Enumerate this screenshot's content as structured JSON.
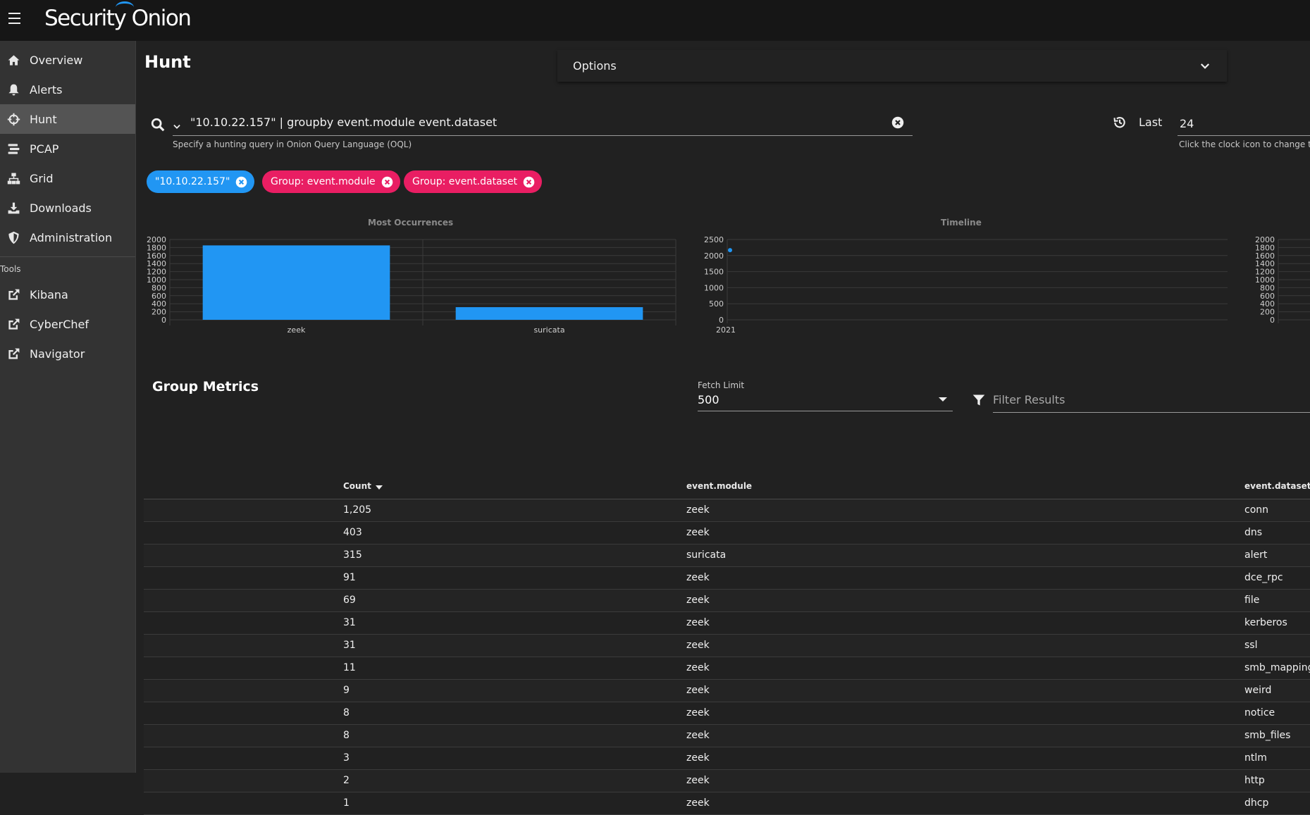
{
  "app": {
    "logo_text": "Security Onion"
  },
  "sidebar": {
    "items": [
      {
        "label": "Overview",
        "icon": "home-icon"
      },
      {
        "label": "Alerts",
        "icon": "bell-icon"
      },
      {
        "label": "Hunt",
        "icon": "crosshairs-icon",
        "active": true
      },
      {
        "label": "PCAP",
        "icon": "stream-icon"
      },
      {
        "label": "Grid",
        "icon": "sitemap-icon"
      },
      {
        "label": "Downloads",
        "icon": "download-icon"
      },
      {
        "label": "Administration",
        "icon": "shield-icon"
      }
    ],
    "tools_label": "Tools",
    "tools": [
      {
        "label": "Kibana",
        "icon": "external-link-icon"
      },
      {
        "label": "CyberChef",
        "icon": "external-link-icon"
      },
      {
        "label": "Navigator",
        "icon": "external-link-icon"
      }
    ]
  },
  "page": {
    "title": "Hunt"
  },
  "options": {
    "label": "Options"
  },
  "query": {
    "value": "\"10.10.22.157\" | groupby event.module event.dataset",
    "hint": "Specify a hunting query in Onion Query Language (OQL)"
  },
  "date_range": {
    "label": "Last",
    "value": "24",
    "hint": "Click the clock icon to change t"
  },
  "chips": [
    {
      "label": "\"10.10.22.157\"",
      "color": "#2196f3"
    },
    {
      "label": "Group: event.module",
      "color": "#e91e63"
    },
    {
      "label": "Group: event.dataset",
      "color": "#e91e63"
    }
  ],
  "chart_data": [
    {
      "type": "bar",
      "title": "Most Occurrences",
      "categories": [
        "zeek",
        "suricata"
      ],
      "values": [
        1853,
        315
      ],
      "ylim": [
        0,
        2000
      ],
      "yticks": [
        "2000",
        "1800",
        "1600",
        "1400",
        "1200",
        "1000",
        "800",
        "600",
        "400",
        "200",
        "0"
      ],
      "color": "#2196f3",
      "grid": true
    },
    {
      "type": "scatter",
      "title": "Timeline",
      "x": [
        "2021"
      ],
      "values": [
        2168
      ],
      "ylim": [
        0,
        2500
      ],
      "yticks": [
        "2500",
        "2000",
        "1500",
        "1000",
        "500",
        "0"
      ],
      "xticks": [
        "2021"
      ],
      "color": "#2196f3",
      "grid": true
    },
    {
      "type": "bar",
      "title": "",
      "yticks": [
        "2000",
        "1800",
        "1600",
        "1400",
        "1200",
        "1000",
        "800",
        "600",
        "400",
        "200",
        "0"
      ],
      "ylim": [
        0,
        2000
      ]
    }
  ],
  "group_metrics": {
    "title": "Group Metrics",
    "fetch_limit_label": "Fetch Limit",
    "fetch_limit_value": "500",
    "filter_placeholder": "Filter Results",
    "columns": [
      "Count",
      "event.module",
      "event.dataset"
    ],
    "rows": [
      [
        "1,205",
        "zeek",
        "conn"
      ],
      [
        "403",
        "zeek",
        "dns"
      ],
      [
        "315",
        "suricata",
        "alert"
      ],
      [
        "91",
        "zeek",
        "dce_rpc"
      ],
      [
        "69",
        "zeek",
        "file"
      ],
      [
        "31",
        "zeek",
        "kerberos"
      ],
      [
        "31",
        "zeek",
        "ssl"
      ],
      [
        "11",
        "zeek",
        "smb_mapping"
      ],
      [
        "9",
        "zeek",
        "weird"
      ],
      [
        "8",
        "zeek",
        "notice"
      ],
      [
        "8",
        "zeek",
        "smb_files"
      ],
      [
        "3",
        "zeek",
        "ntlm"
      ],
      [
        "2",
        "zeek",
        "http"
      ],
      [
        "1",
        "zeek",
        "dhcp"
      ]
    ]
  }
}
